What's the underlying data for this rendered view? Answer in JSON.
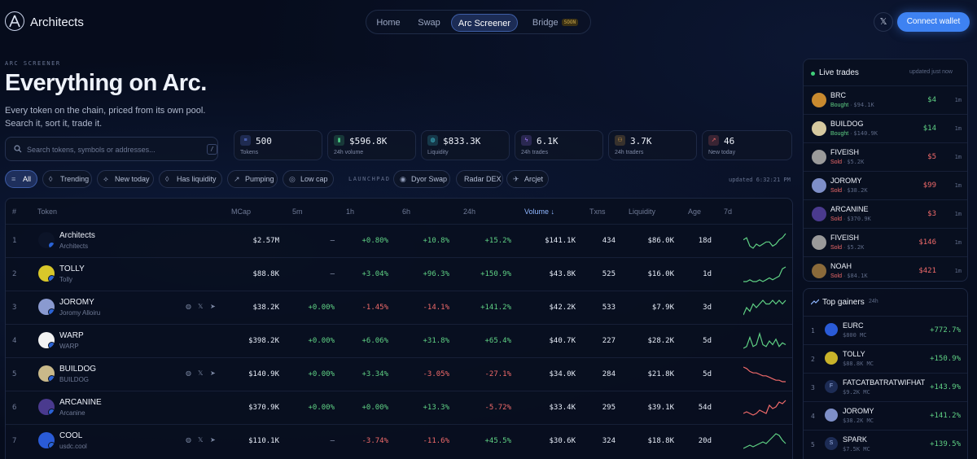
{
  "nav": {
    "brand": "Architects",
    "tabs": [
      {
        "label": "Home",
        "active": false
      },
      {
        "label": "Swap",
        "active": false
      },
      {
        "label": "Arc Screener",
        "active": true
      },
      {
        "label": "Bridge",
        "active": false,
        "badge": "SOON"
      }
    ],
    "x_icon": "x-logo-icon",
    "connect_label": "Connect wallet"
  },
  "hero": {
    "eyebrow": "ARC SCREENER",
    "title": "Everything on Arc.",
    "subtitle_line1": "Every token on the chain, priced from its own pool.",
    "subtitle_line2": "Search it, sort it, trade it."
  },
  "search": {
    "placeholder": "Search tokens, symbols or addresses...",
    "shortcut": "/"
  },
  "stats": [
    {
      "value": "500",
      "label": "Tokens",
      "icon": "layers-icon",
      "color": "#6f8cff"
    },
    {
      "value": "$596.8K",
      "label": "24h volume",
      "icon": "bar-chart-icon",
      "color": "#4ccf86"
    },
    {
      "value": "$833.3K",
      "label": "Liquidity",
      "icon": "droplet-icon",
      "color": "#43c7d8"
    },
    {
      "value": "6.1K",
      "label": "24h trades",
      "icon": "bolt-icon",
      "color": "#a57cff"
    },
    {
      "value": "3.7K",
      "label": "24h traders",
      "icon": "users-icon",
      "color": "#e7a94a"
    },
    {
      "value": "46",
      "label": "New today",
      "icon": "sparkline-icon",
      "color": "#f06a6a"
    }
  ],
  "filters": [
    {
      "label": "All",
      "icon": "layers-icon",
      "active": true
    },
    {
      "label": "Trending",
      "icon": "flame-icon",
      "active": false
    },
    {
      "label": "New today",
      "icon": "sparkle-icon",
      "active": false
    },
    {
      "label": "Has liquidity",
      "icon": "droplet-icon",
      "active": false
    },
    {
      "label": "Pumping",
      "icon": "trend-up-icon",
      "active": false
    },
    {
      "label": "Low cap",
      "icon": "target-icon",
      "active": false
    }
  ],
  "launchpad": {
    "label": "LAUNCHPAD",
    "items": [
      {
        "label": "Dyor Swap",
        "icon": "dyor-logo-icon"
      },
      {
        "label": "Radar DEX",
        "icon": ""
      },
      {
        "label": "Arcjet",
        "icon": "rocket-icon"
      }
    ]
  },
  "updated": "updated 6:32:21 PM",
  "table": {
    "headers": {
      "num": "#",
      "token": "Token",
      "mcap": "MCap",
      "m5": "5m",
      "h1": "1h",
      "h6": "6h",
      "h24": "24h",
      "volume": "Volume ↓",
      "txns": "Txns",
      "liquidity": "Liquidity",
      "age": "Age",
      "d7": "7d"
    },
    "rows": [
      {
        "idx": "1",
        "name": "Architects",
        "sub": "Architects",
        "mcap": "$2.57M",
        "m5": "—",
        "h1": "+0.80%",
        "h6": "+10.8%",
        "h24": "+15.2%",
        "volume": "$141.1K",
        "txns": "434",
        "liquidity": "$86.0K",
        "age": "18d",
        "avatar": "architects-logo",
        "social": false,
        "trend": [
          9,
          10,
          6,
          5,
          7,
          6,
          7,
          8,
          8,
          6,
          7,
          9,
          10,
          12
        ],
        "trend_color": "#5fd184"
      },
      {
        "idx": "2",
        "name": "TOLLY",
        "sub": "Tolly",
        "mcap": "$88.8K",
        "m5": "—",
        "h1": "+3.04%",
        "h6": "+96.3%",
        "h24": "+150.9%",
        "volume": "$43.8K",
        "txns": "525",
        "liquidity": "$16.0K",
        "age": "1d",
        "avatar": "tolly-avatar",
        "social": false,
        "trend": [
          3,
          3,
          4,
          3,
          3,
          4,
          3,
          4,
          5,
          4,
          5,
          6,
          10,
          11
        ],
        "trend_color": "#5fd184"
      },
      {
        "idx": "3",
        "name": "JOROMY",
        "sub": "Joromy Alloiru",
        "mcap": "$38.2K",
        "m5": "+0.00%",
        "h1": "-1.45%",
        "h6": "-14.1%",
        "h24": "+141.2%",
        "volume": "$42.2K",
        "txns": "533",
        "liquidity": "$7.9K",
        "age": "3d",
        "avatar": "joromy-avatar",
        "social": true,
        "trend": [
          6,
          8,
          7,
          9,
          8,
          9,
          10,
          9,
          9,
          10,
          9,
          10,
          9,
          10
        ],
        "trend_color": "#5fd184"
      },
      {
        "idx": "4",
        "name": "WARP",
        "sub": "WARP",
        "mcap": "$398.2K",
        "m5": "+0.00%",
        "h1": "+6.06%",
        "h6": "+31.8%",
        "h24": "+65.4%",
        "volume": "$40.7K",
        "txns": "227",
        "liquidity": "$28.2K",
        "age": "5d",
        "avatar": "warp-logo",
        "social": false,
        "trend": [
          4,
          5,
          10,
          5,
          6,
          12,
          6,
          5,
          8,
          6,
          9,
          5,
          7,
          6
        ],
        "trend_color": "#5fd184"
      },
      {
        "idx": "5",
        "name": "BUILDOG",
        "sub": "BUILDOG",
        "mcap": "$140.9K",
        "m5": "+0.00%",
        "h1": "+3.34%",
        "h6": "-3.05%",
        "h24": "-27.1%",
        "volume": "$34.0K",
        "txns": "284",
        "liquidity": "$21.8K",
        "age": "5d",
        "avatar": "buildog-avatar",
        "social": true,
        "trend": [
          12,
          11,
          9,
          8,
          8,
          7,
          6,
          6,
          5,
          4,
          3,
          3,
          2,
          2
        ],
        "trend_color": "#f06a6a"
      },
      {
        "idx": "6",
        "name": "ARCANINE",
        "sub": "Arcanine",
        "mcap": "$370.9K",
        "m5": "+0.00%",
        "h1": "+0.00%",
        "h6": "+13.3%",
        "h24": "-5.72%",
        "volume": "$33.4K",
        "txns": "295",
        "liquidity": "$39.1K",
        "age": "54d",
        "avatar": "arcanine-avatar",
        "social": false,
        "trend": [
          4,
          5,
          4,
          3,
          4,
          6,
          5,
          4,
          9,
          7,
          8,
          11,
          10,
          12
        ],
        "trend_color": "#f06a6a"
      },
      {
        "idx": "7",
        "name": "COOL",
        "sub": "usdc.cool",
        "mcap": "$110.1K",
        "m5": "—",
        "h1": "-3.74%",
        "h6": "-11.6%",
        "h24": "+45.5%",
        "volume": "$30.6K",
        "txns": "324",
        "liquidity": "$18.8K",
        "age": "20d",
        "avatar": "cool-logo",
        "social": true,
        "trend": [
          3,
          4,
          5,
          4,
          5,
          6,
          7,
          6,
          8,
          10,
          12,
          11,
          8,
          6
        ],
        "trend_color": "#5fd184"
      }
    ]
  },
  "live_trades": {
    "title": "Live trades",
    "note": "updated just now",
    "items": [
      {
        "name": "BRC",
        "side": "Bought",
        "mc": "$94.1K",
        "amount": "$4",
        "time": "1m",
        "color": "#c98a2f"
      },
      {
        "name": "BUILDOG",
        "side": "Bought",
        "mc": "$140.9K",
        "amount": "$14",
        "time": "1m",
        "color": "#d6c9a0"
      },
      {
        "name": "FIVEISH",
        "side": "Sold",
        "mc": "$5.2K",
        "amount": "$5",
        "time": "1m",
        "color": "#9a9a9a"
      },
      {
        "name": "JOROMY",
        "side": "Sold",
        "mc": "$38.2K",
        "amount": "$99",
        "time": "1m",
        "color": "#7e8fc8"
      },
      {
        "name": "ARCANINE",
        "side": "Sold",
        "mc": "$370.9K",
        "amount": "$3",
        "time": "1m",
        "color": "#4a3a8e"
      },
      {
        "name": "FIVEISH",
        "side": "Sold",
        "mc": "$5.2K",
        "amount": "$146",
        "time": "1m",
        "color": "#9a9a9a"
      },
      {
        "name": "NOAH",
        "side": "Sold",
        "mc": "$84.1K",
        "amount": "$421",
        "time": "1m",
        "color": "#8a6a3a"
      }
    ]
  },
  "top_gainers": {
    "title": "Top gainers",
    "period": "24h",
    "items": [
      {
        "idx": "1",
        "name": "EURC",
        "mc": "$800 MC",
        "pct": "+772.7%",
        "color": "#2a5bd7"
      },
      {
        "idx": "2",
        "name": "TOLLY",
        "mc": "$88.8K MC",
        "pct": "+150.9%",
        "color": "#c9b32a"
      },
      {
        "idx": "3",
        "name": "FATCATBATRATWIFHAT",
        "mc": "$9.2K MC",
        "pct": "+143.9%",
        "color": "#1d2c55",
        "letter": "F"
      },
      {
        "idx": "4",
        "name": "JOROMY",
        "mc": "$38.2K MC",
        "pct": "+141.2%",
        "color": "#7e8fc8"
      },
      {
        "idx": "5",
        "name": "SPARK",
        "mc": "$7.5K MC",
        "pct": "+139.5%",
        "color": "#1d2c55",
        "letter": "S"
      }
    ]
  }
}
